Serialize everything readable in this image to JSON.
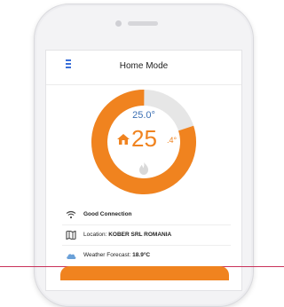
{
  "app": {
    "title": "Home Mode"
  },
  "thermostat": {
    "set_temp": "25.0°",
    "current_temp": "25",
    "current_temp_decimal": ".4°",
    "target_fraction": 0.8
  },
  "status_rows": [
    {
      "icon": "wifi-icon",
      "label": "Good Connection",
      "value": ""
    },
    {
      "icon": "map-icon",
      "label": "Location:",
      "value": "KOBER SRL ROMANIA"
    },
    {
      "icon": "cloud-icon",
      "label": "Weather Forecast:",
      "value": "18.9°C"
    }
  ],
  "colors": {
    "accent": "#f0831f",
    "track": "#e6e6e6",
    "set_temp_text": "#3b6fb3",
    "menu": "#3a6fd8",
    "bottom_line": "#c9325a"
  }
}
